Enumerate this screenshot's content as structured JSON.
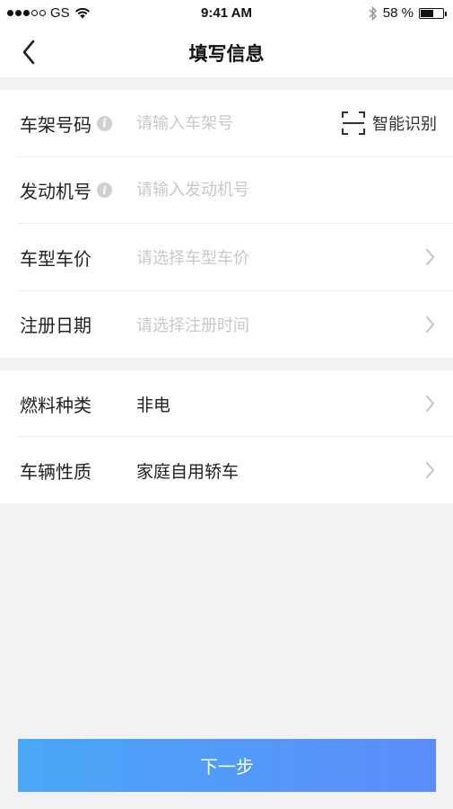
{
  "status_bar": {
    "carrier": "GS",
    "time": "9:41 AM",
    "battery": "58 %",
    "battery_level": 0.58
  },
  "nav": {
    "title": "填写信息",
    "back_icon": "chevron-left-icon"
  },
  "form": {
    "vin": {
      "label": "车架号码",
      "placeholder": "请输入车架号",
      "scan_label": "智能识别"
    },
    "engine": {
      "label": "发动机号",
      "placeholder": "请输入发动机号"
    },
    "model_price": {
      "label": "车型车价",
      "placeholder": "请选择车型车价"
    },
    "register_date": {
      "label": "注册日期",
      "placeholder": "请选择注册时间"
    },
    "fuel_type": {
      "label": "燃料种类",
      "value": "非电"
    },
    "vehicle_nature": {
      "label": "车辆性质",
      "value": "家庭自用轿车"
    }
  },
  "next_button": {
    "label": "下一步"
  },
  "colors": {
    "button_gradient_start": "#4aa8f8",
    "button_gradient_end": "#5b8cf9",
    "background": "#f2f2f4",
    "placeholder": "#c8c8c8"
  }
}
